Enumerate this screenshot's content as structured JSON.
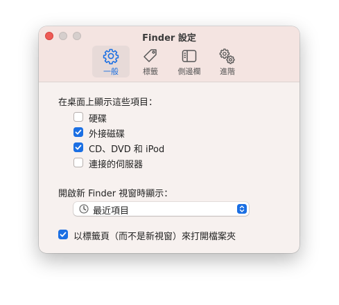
{
  "window": {
    "title": "Finder 設定"
  },
  "toolbar": {
    "tabs": [
      {
        "label": "一般",
        "icon": "gear-icon",
        "selected": true
      },
      {
        "label": "標籤",
        "icon": "tag-icon",
        "selected": false
      },
      {
        "label": "側邊欄",
        "icon": "sidebar-icon",
        "selected": false
      },
      {
        "label": "進階",
        "icon": "gears-icon",
        "selected": false
      }
    ]
  },
  "desktop_section": {
    "heading": "在桌面上顯示這些項目：",
    "items": [
      {
        "label": "硬碟",
        "checked": false
      },
      {
        "label": "外接磁碟",
        "checked": true
      },
      {
        "label": "CD、DVD 和 iPod",
        "checked": true
      },
      {
        "label": "連接的伺服器",
        "checked": false
      }
    ]
  },
  "new_window_section": {
    "heading": "開啟新 Finder 視窗時顯示：",
    "selected_value": "最近項目",
    "icon": "clock-icon"
  },
  "tabs_option": {
    "label": "以標籤頁（而不是新視窗）來打開檔案夾",
    "checked": true
  },
  "colors": {
    "accent": "#1b6fe3",
    "close": "#ee5b56"
  }
}
